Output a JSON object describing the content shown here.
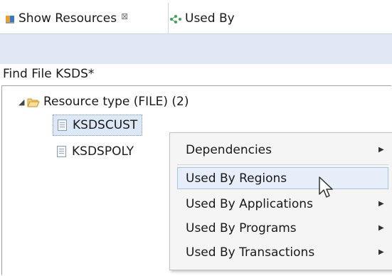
{
  "tabs": [
    {
      "label": "Show Resources",
      "icon": "resources-icon",
      "close_glyph": "⊠",
      "active": true
    },
    {
      "label": "Used By",
      "icon": "used-by-icon",
      "active": false
    }
  ],
  "find_label": "Find File KSDS*",
  "tree": {
    "root": {
      "label": "Resource type (FILE)  (2)",
      "expanded": true
    },
    "items": [
      {
        "label": "KSDSCUST",
        "selected": true
      },
      {
        "label": "KSDSPOLY",
        "selected": false
      }
    ]
  },
  "context_menu": {
    "items": [
      {
        "label": "Dependencies",
        "has_submenu": true
      },
      {
        "label": "Used By Regions",
        "has_submenu": false,
        "hovered": true
      },
      {
        "label": "Used By Applications",
        "has_submenu": true
      },
      {
        "label": "Used By Programs",
        "has_submenu": true
      },
      {
        "label": "Used By Transactions",
        "has_submenu": true
      }
    ]
  },
  "colors": {
    "toolbar_bg": "#dfe8f4",
    "selection_bg": "#dde8f6",
    "menu_hover_bg": "#e5eef9",
    "folder": "#e8b84a"
  }
}
